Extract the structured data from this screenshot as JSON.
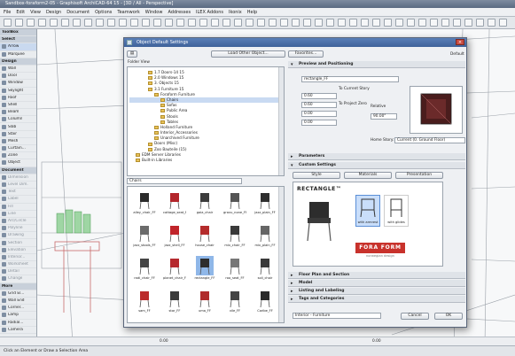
{
  "window": {
    "title": "Sandbox-foraform2-05 - Graphisoft ArchiCAD-64 15 - [3D / All - Perspective]"
  },
  "menu": [
    "File",
    "Edit",
    "View",
    "Design",
    "Document",
    "Options",
    "Teamwork",
    "Window",
    "Addresses",
    "ILEX Addons",
    "Ikonix",
    "Help"
  ],
  "toolbox": {
    "title": "ToolBox",
    "select_label": "Select",
    "items": [
      {
        "label": "Arrow",
        "type": "tool",
        "state": "hi"
      },
      {
        "label": "Marquee",
        "type": "tool"
      },
      {
        "label": "Design",
        "type": "section"
      },
      {
        "label": "Wall",
        "type": "tool"
      },
      {
        "label": "Door",
        "type": "tool"
      },
      {
        "label": "Window",
        "type": "tool"
      },
      {
        "label": "Skylight",
        "type": "tool"
      },
      {
        "label": "Roof",
        "type": "tool"
      },
      {
        "label": "Shell",
        "type": "tool"
      },
      {
        "label": "Beam",
        "type": "tool"
      },
      {
        "label": "Column",
        "type": "tool"
      },
      {
        "label": "Slab",
        "type": "tool"
      },
      {
        "label": "Stair",
        "type": "tool"
      },
      {
        "label": "Mesh",
        "type": "tool"
      },
      {
        "label": "Curtain...",
        "type": "tool"
      },
      {
        "label": "Zone",
        "type": "tool"
      },
      {
        "label": "Object",
        "type": "tool"
      },
      {
        "label": "Document",
        "type": "section"
      },
      {
        "label": "Dimension",
        "type": "tool",
        "state": "dim"
      },
      {
        "label": "Level Dim.",
        "type": "tool",
        "state": "dim"
      },
      {
        "label": "Text",
        "type": "tool",
        "state": "dim"
      },
      {
        "label": "Label",
        "type": "tool",
        "state": "dim"
      },
      {
        "label": "Fill",
        "type": "tool",
        "state": "dim"
      },
      {
        "label": "Line",
        "type": "tool",
        "state": "dim"
      },
      {
        "label": "Arc/Circle",
        "type": "tool",
        "state": "dim"
      },
      {
        "label": "Polyline",
        "type": "tool",
        "state": "dim"
      },
      {
        "label": "Drawing",
        "type": "tool",
        "state": "dim"
      },
      {
        "label": "Section",
        "type": "tool",
        "state": "dim"
      },
      {
        "label": "Elevation",
        "type": "tool",
        "state": "dim"
      },
      {
        "label": "Interior...",
        "type": "tool",
        "state": "dim"
      },
      {
        "label": "Worksheet",
        "type": "tool",
        "state": "dim"
      },
      {
        "label": "Detail",
        "type": "tool",
        "state": "dim"
      },
      {
        "label": "Change",
        "type": "tool",
        "state": "dim"
      },
      {
        "label": "More",
        "type": "section"
      },
      {
        "label": "Grid El...",
        "type": "tool"
      },
      {
        "label": "Wall End",
        "type": "tool"
      },
      {
        "label": "Corner...",
        "type": "tool"
      },
      {
        "label": "Lamp",
        "type": "tool"
      },
      {
        "label": "Radial...",
        "type": "tool"
      },
      {
        "label": "Camera",
        "type": "tool"
      }
    ]
  },
  "dialog": {
    "title": "Object Default Settings",
    "load_other_label": "Load Other Object...",
    "folder_view_label": "Folder View",
    "favorites_label": "Favorites...",
    "default_label": "Default",
    "tree": [
      {
        "label": "1.7 Doors-14 15",
        "level": 3
      },
      {
        "label": "2.0 Windows 15",
        "level": 3
      },
      {
        "label": "3. Objects 15",
        "level": 3
      },
      {
        "label": "3.1 Furniture 15",
        "level": 3
      },
      {
        "label": "Foraform Furniture",
        "level": 4
      },
      {
        "label": "Chairs",
        "level": 5
      },
      {
        "label": "Sofas",
        "level": 5
      },
      {
        "label": "Public Area",
        "level": 5
      },
      {
        "label": "Stools",
        "level": 5
      },
      {
        "label": "Tables",
        "level": 5
      },
      {
        "label": "Holland Furniture",
        "level": 4
      },
      {
        "label": "Interior_Accessories",
        "level": 4
      },
      {
        "label": "Unarchived Furniture",
        "level": 4
      },
      {
        "label": "Doors (Misc)",
        "level": 3
      },
      {
        "label": "Zoo Bauteile (15)",
        "level": 3
      },
      {
        "label": "EDM Server Libraries",
        "level": 1
      },
      {
        "label": "Built-in Libraries",
        "level": 1
      }
    ],
    "tree_selected_index": 5,
    "grid_path": "Chairs",
    "objects": [
      {
        "label": "alley_chair_FF",
        "color": "#2b2b2b"
      },
      {
        "label": "cottage_seat_FF",
        "color": "#b3262b"
      },
      {
        "label": "gaia_chair",
        "color": "#3c3c3c"
      },
      {
        "label": "gravu_none_FF",
        "color": "#555555"
      },
      {
        "label": "jazz_plain_FF",
        "color": "#2f2f2f"
      },
      {
        "label": "jazz_stools_FF",
        "color": "#6b6b6b"
      },
      {
        "label": "jazz_shell_FF",
        "color": "#c0242a"
      },
      {
        "label": "house_chair",
        "color": "#b42c2c"
      },
      {
        "label": "mix_chair_FF",
        "color": "#3a3a3a"
      },
      {
        "label": "mix_plain_FF",
        "color": "#666666"
      },
      {
        "label": "radi_chair_FF",
        "color": "#444444"
      },
      {
        "label": "planet_chair_FF",
        "color": "#b52a2f"
      },
      {
        "label": "rectangle_FF",
        "color": "#2d2d2d",
        "selected": true
      },
      {
        "label": "roo_seat_FF",
        "color": "#777777"
      },
      {
        "label": "soli_chair",
        "color": "#3a3a3a"
      },
      {
        "label": "sam_FF",
        "color": "#bb2c2c"
      },
      {
        "label": "star_FF",
        "color": "#3b3b3b"
      },
      {
        "label": "uma_FF",
        "color": "#b02b2b"
      },
      {
        "label": "vile_FF",
        "color": "#444444"
      },
      {
        "label": "Caribe_FF",
        "color": "#2a2a2a"
      }
    ],
    "selected_object": "rectangle_FF",
    "preview": {
      "section": "Preview and Positioning",
      "field1": "0.60",
      "field2": "0.60",
      "to_current_story": "To Current Story",
      "to_project_zero": "To Project Zero",
      "field3": "0.00",
      "field4": "0.00",
      "relative_label": "Relative",
      "angle": "90.00°",
      "home_story_label": "Home Story:",
      "home_story_value": "Current (0. Ground Floor)"
    },
    "sections": {
      "parameters": "Parameters",
      "custom": "Custom Settings",
      "floor_plan": "Floor Plan and Section",
      "model": "Model",
      "listing": "Listing and Labeling",
      "tags": "Tags and Categories"
    },
    "custom_tabs": [
      "Style",
      "Materials",
      "Presentation"
    ],
    "brand_name": "RECTANGLE™",
    "brand_logo": "FORA FORM",
    "brand_tagline": "norwegian design",
    "style_options": [
      "with armrest",
      "with glides"
    ],
    "layer_value": "Interior - Furniture",
    "cancel_label": "Cancel",
    "ok_label": "OK"
  },
  "status": {
    "text": "Click an Element or Draw a Selection Area",
    "info_values": [
      "0.00",
      "0.00"
    ]
  },
  "accent": "#3f6299"
}
